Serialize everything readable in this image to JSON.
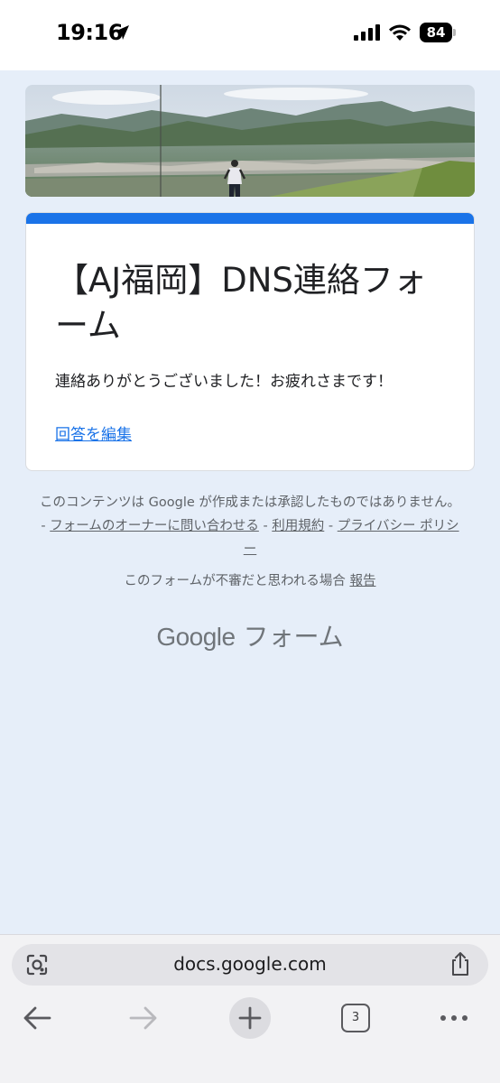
{
  "status_bar": {
    "time": "19:16",
    "battery": "84",
    "icons": [
      "location-arrow-icon",
      "signal-icon",
      "wifi-icon",
      "battery-icon"
    ]
  },
  "form": {
    "title": "【AJ福岡】DNS連絡フォーム",
    "confirmation": "連絡ありがとうございました！お疲れさまです！",
    "edit_link": "回答を編集",
    "accent_color": "#1a73e8"
  },
  "footer": {
    "disclaimer_prefix": "このコンテンツは Google が作成または承認したものではありません。 - ",
    "contact_owner": "フォームのオーナーに問い合わせる",
    "sep1": " - ",
    "terms": "利用規約",
    "sep2": " - ",
    "privacy": "プライバシー ポリシー",
    "report_prefix": "このフォームが不審だと思われる場合 ",
    "report_link": "報告",
    "brand_google": "Google",
    "brand_forms": " フォーム"
  },
  "browser": {
    "url": "docs.google.com",
    "tab_count": "3",
    "icons": [
      "lens-icon",
      "share-icon",
      "back-icon",
      "forward-icon",
      "new-tab-icon",
      "tabs-icon",
      "more-icon"
    ]
  }
}
